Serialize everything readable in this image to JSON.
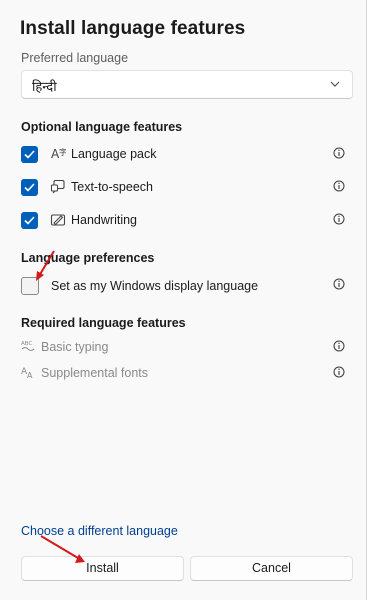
{
  "dialog": {
    "title": "Install language features",
    "preferred_language_label": "Preferred language",
    "preferred_language_value": "हिन्दी",
    "optional_section_title": "Optional language features",
    "optional_features": [
      {
        "label": "Language pack",
        "checked": true,
        "icon": "language-pack-icon"
      },
      {
        "label": "Text-to-speech",
        "checked": true,
        "icon": "speech-icon"
      },
      {
        "label": "Handwriting",
        "checked": true,
        "icon": "handwriting-icon"
      }
    ],
    "preferences_section_title": "Language preferences",
    "display_language_label": "Set as my Windows display language",
    "display_language_checked": false,
    "required_section_title": "Required language features",
    "required_features": [
      {
        "label": "Basic typing",
        "icon": "abc-icon"
      },
      {
        "label": "Supplemental fonts",
        "icon": "font-icon"
      }
    ],
    "choose_link": "Choose a different language",
    "install_button": "Install",
    "cancel_button": "Cancel"
  },
  "colors": {
    "accent": "#005fb8",
    "link": "#003e92",
    "annotation_arrow": "#d4191c"
  }
}
